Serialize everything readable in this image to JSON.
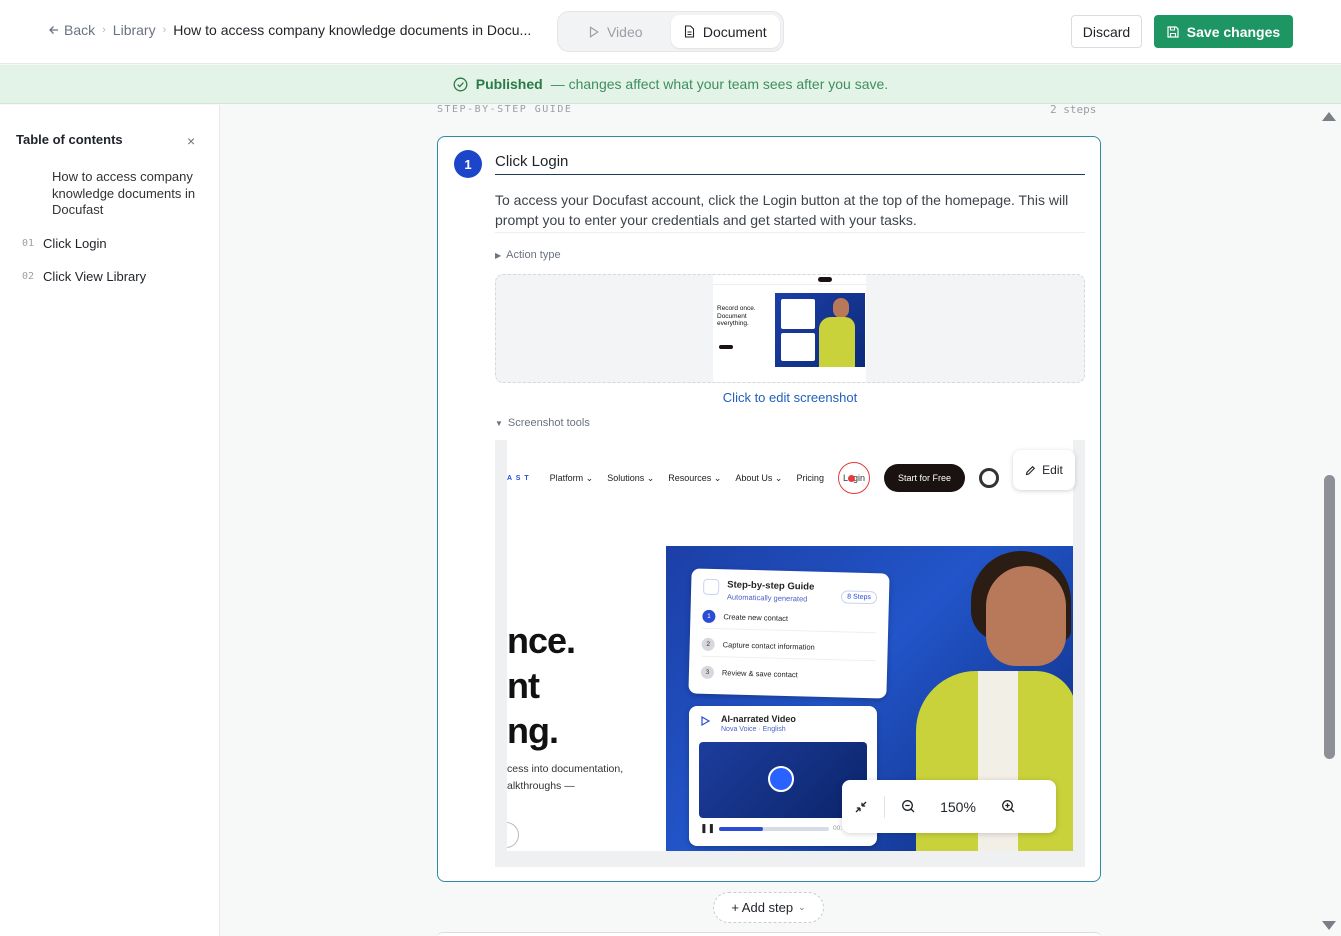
{
  "header": {
    "back_label": "Back",
    "breadcrumb_library": "Library",
    "breadcrumb_current": "How to access company knowledge documents in Docu...",
    "tabs": [
      {
        "label": "Video",
        "active": false
      },
      {
        "label": "Document",
        "active": true
      }
    ],
    "discard_label": "Discard",
    "save_label": "Save changes"
  },
  "banner": {
    "status": "Published",
    "message": "— changes affect what your team sees after you save.",
    "color": "#1e9663"
  },
  "sidebar": {
    "title": "Table of contents",
    "close_glyph": "×",
    "doc_title": "How to access company knowledge documents in Docufast",
    "items": [
      {
        "num": "01",
        "label": "Click Login"
      },
      {
        "num": "02",
        "label": "Click View Library"
      }
    ]
  },
  "guide": {
    "section_label": "STEP-BY-STEP GUIDE",
    "step_count": "2 steps"
  },
  "step": {
    "number": "1",
    "title": "Click Login",
    "description": "To access your Docufast account, click the Login button at the top of the homepage. This will prompt you to enter your credentials and get started with your tasks.",
    "action_type_label": "Action type",
    "edit_screenshot_link": "Click to edit screenshot",
    "screenshot_tools_label": "Screenshot tools",
    "edit_label": "Edit",
    "zoom_level": "150%"
  },
  "screenshot": {
    "logo_text": "A S T",
    "nav": [
      "Platform",
      "Solutions",
      "Resources",
      "About Us"
    ],
    "pricing": "Pricing",
    "login": "Login",
    "cta": "Start for Free",
    "hero_lines": [
      "nce.",
      "nt",
      "ng."
    ],
    "hero_sub_lines": [
      "cess into documentation,",
      "alkthroughs —"
    ],
    "guide_card": {
      "title": "Step-by-step Guide",
      "subtitle": "Automatically generated",
      "badge": "8 Steps",
      "rows": [
        {
          "num": "1",
          "label": "Create new contact"
        },
        {
          "num": "2",
          "label": "Capture contact information"
        },
        {
          "num": "3",
          "label": "Review & save contact"
        }
      ]
    },
    "video_card": {
      "title": "AI-narrated Video",
      "subtitle": "Nova Voice · English",
      "time": "00:"
    },
    "thumb_headline": "Record once. Document everything."
  },
  "add_step_label": "+ Add step",
  "colors": {
    "accent": "#1e9663",
    "step_badge": "#1c46c9",
    "card_border": "#2f8aa3",
    "link": "#1f5fbf"
  }
}
